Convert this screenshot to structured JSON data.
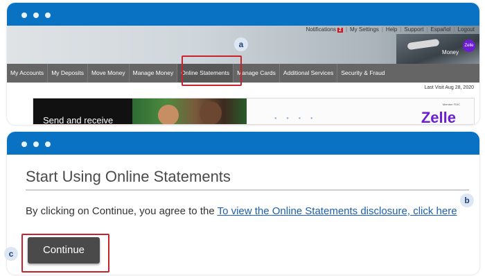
{
  "window1": {
    "top_links": {
      "notifications": "Notifications",
      "notifications_count": "2",
      "my_settings": "My Settings",
      "help": "Help",
      "support": "Support",
      "espanol": "Español",
      "logout": "Logout"
    },
    "banner": {
      "chip": "Zelle",
      "money_text": "Money"
    },
    "nav": [
      "My Accounts",
      "My Deposits",
      "Move Money",
      "Manage Money",
      "Online Statements",
      "Manage Cards",
      "Additional Services",
      "Security & Fraud"
    ],
    "active_nav": "Online Statements",
    "last_visit": "Last Visit Aug 28, 2020",
    "promo": {
      "headline": "Send and receive",
      "member": "Member FDIC",
      "brand": "Zelle"
    }
  },
  "window2": {
    "title": "Start Using Online Statements",
    "body_prefix": "By clicking on Continue, you agree to the ",
    "disclosure_link": "To view the Online Statements disclosure, click here",
    "continue_label": "Continue"
  },
  "callouts": {
    "a": "a",
    "b": "b",
    "c": "c"
  },
  "colors": {
    "titlebar": "#0a72c3",
    "nav_bg": "#656565",
    "highlight": "#c8232c",
    "button": "#4a4a4a",
    "link": "#1a5fb4",
    "badge": "#d0121b"
  }
}
